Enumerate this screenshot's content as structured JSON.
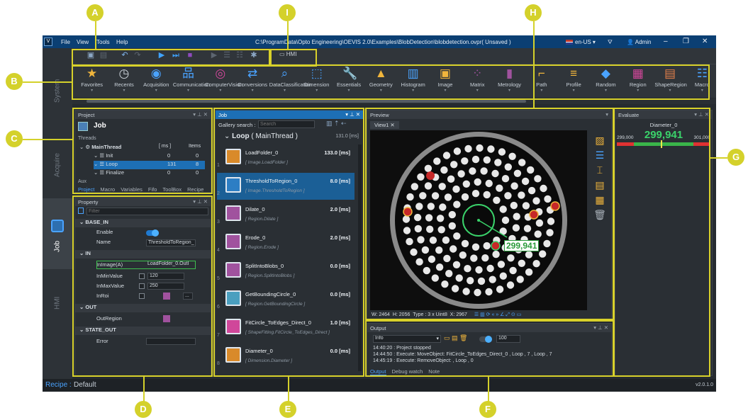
{
  "app": {
    "menu": [
      "File",
      "View",
      "Tools",
      "Help"
    ],
    "title": "C:\\ProgramData\\Opto Engineering\\OEVIS 2.0\\Examples\\BlobDetection\\blobdetection.ovpr( Unsaved )",
    "language": "en-US",
    "user": "Admin",
    "win_controls": [
      "–",
      "❐",
      "✕"
    ]
  },
  "sidebar": {
    "items": [
      "System",
      "Acquire",
      "Job",
      "HMI"
    ]
  },
  "toolbar": {
    "hmi_label": "HMI"
  },
  "ribbon": {
    "items": [
      {
        "label": "Favorites",
        "icon": "star-icon"
      },
      {
        "label": "Recents",
        "icon": "clock-icon"
      },
      {
        "label": "Acquisition",
        "icon": "camera-icon"
      },
      {
        "label": "Communication",
        "icon": "network-icon"
      },
      {
        "label": "ComputerVision",
        "icon": "eye-icon"
      },
      {
        "label": "Conversions",
        "icon": "convert-icon"
      },
      {
        "label": "DataClassification",
        "icon": "magnifier-icon"
      },
      {
        "label": "Dimension",
        "icon": "dimension-icon"
      },
      {
        "label": "Essentials",
        "icon": "wrench-icon"
      },
      {
        "label": "Geometry",
        "icon": "shapes-icon"
      },
      {
        "label": "Histogram",
        "icon": "histogram-icon"
      },
      {
        "label": "Image",
        "icon": "image-icon"
      },
      {
        "label": "Matrix",
        "icon": "matrix-icon"
      },
      {
        "label": "Metrology",
        "icon": "metrology-icon"
      },
      {
        "label": "Path",
        "icon": "path-icon"
      },
      {
        "label": "Profile",
        "icon": "profile-icon"
      },
      {
        "label": "Random",
        "icon": "random-icon"
      },
      {
        "label": "Region",
        "icon": "region-icon"
      },
      {
        "label": "ShapeRegion",
        "icon": "shape-region-icon"
      },
      {
        "label": "Macro",
        "icon": "macro-icon"
      }
    ]
  },
  "project": {
    "header": "Project",
    "title": "Job",
    "threads_label": "Threads",
    "col_ms": "[ ms ]",
    "col_items": "Items",
    "rows": [
      {
        "name": "MainThread",
        "ms": "",
        "items": ""
      },
      {
        "name": "Init",
        "ms": "0",
        "items": "0"
      },
      {
        "name": "Loop",
        "ms": "131",
        "items": "8"
      },
      {
        "name": "Finalize",
        "ms": "0",
        "items": "0"
      }
    ],
    "aux": "Aux",
    "tabs": [
      "Project",
      "Macro",
      "Variables",
      "Fifo",
      "ToolBox",
      "Recipe"
    ]
  },
  "property": {
    "header": "Property",
    "filter_placeholder": "Filter",
    "sections": [
      {
        "title": "BASE_IN",
        "rows": [
          {
            "name": "Enable",
            "value": ""
          },
          {
            "name": "Name",
            "value": "ThresholdToRegion_"
          }
        ]
      },
      {
        "title": "IN",
        "rows": [
          {
            "name": "InImage(A)",
            "value": "LoadFolder_0.OutI"
          },
          {
            "name": "InMinValue",
            "value": "120"
          },
          {
            "name": "InMaxValue",
            "value": "250"
          },
          {
            "name": "InRoi",
            "value": ""
          }
        ]
      },
      {
        "title": "OUT",
        "rows": [
          {
            "name": "OutRegion",
            "value": ""
          }
        ]
      },
      {
        "title": "STATE_OUT",
        "rows": [
          {
            "name": "Error",
            "value": ""
          }
        ]
      }
    ]
  },
  "job": {
    "header": "Job",
    "gallery_label": "Gallery search :",
    "search_placeholder": "Search",
    "loop_title": "Loop",
    "loop_thread": "( MainThread )",
    "loop_time": "131.0 [ms]",
    "items": [
      {
        "num": "1",
        "name": "LoadFolder_0",
        "cat": "[ Image.LoadFolder ]",
        "time": "133.0 [ms]"
      },
      {
        "num": "2",
        "name": "ThresholdToRegion_0",
        "cat": "[ Image.ThresholdToRegion ]",
        "time": "8.0 [ms]"
      },
      {
        "num": "3",
        "name": "Dilate_0",
        "cat": "[ Region.Dilate ]",
        "time": "2.0 [ms]"
      },
      {
        "num": "4",
        "name": "Erode_0",
        "cat": "[ Region.Erode ]",
        "time": "2.0 [ms]"
      },
      {
        "num": "5",
        "name": "SplitIntoBlobs_0",
        "cat": "[ Region.SplitIntoBlobs ]",
        "time": "0.0 [ms]"
      },
      {
        "num": "6",
        "name": "GetBoundingCircle_0",
        "cat": "[ Region.GetBoundingCircle ]",
        "time": "0.0 [ms]"
      },
      {
        "num": "7",
        "name": "FitCircle_ToEdges_Direct_0",
        "cat": "[ ShapeFitting.FitCircle_ToEdges_Direct ]",
        "time": "1.0 [ms]"
      },
      {
        "num": "8",
        "name": "Diameter_0",
        "cat": "[ Dimension.Diameter ]",
        "time": "0.0 [ms]"
      }
    ]
  },
  "preview": {
    "header": "Preview",
    "tab": "View1",
    "measurement": "299,941",
    "status": {
      "w": "W: 2464",
      "h": "H: 2056",
      "type": "Type : 3 x Uint8",
      "x": "X: 2967"
    }
  },
  "output": {
    "header": "Output",
    "level": "Info",
    "count": "100",
    "lines": [
      "14:40:20 : Project stopped",
      "14:44:50 : Execute: MoveObject: FitCircle_ToEdges_Direct_0 , Loop , 7 , Loop , 7",
      "14:45:19 : Execute: RemoveObject: , Loop , 0"
    ],
    "tabs": [
      "Output",
      "Debug watch",
      "Note"
    ]
  },
  "evaluate": {
    "header": "Evaluate",
    "name": "Diameter_0",
    "value": "299,941",
    "min": "299,000",
    "max": "301,000",
    "fraction": 0.47
  },
  "status": {
    "recipe_label": "Recipe :",
    "recipe_value": "Default",
    "version": "v2.0.1.0"
  },
  "callouts": [
    "A",
    "B",
    "C",
    "D",
    "E",
    "F",
    "G",
    "H",
    "I"
  ],
  "colors": {
    "accent": "#1d6fb5",
    "callout": "#d4d12b",
    "ok": "#3ad26a",
    "bad": "#e03232"
  }
}
